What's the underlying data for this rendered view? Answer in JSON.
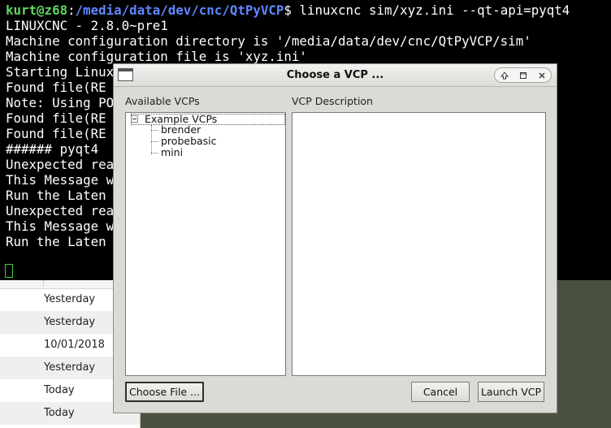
{
  "terminal": {
    "prompt_user": "kurt@z68",
    "prompt_sep": ":",
    "prompt_path": "/media/data/dev/cnc/QtPyVCP",
    "prompt_command": "$ linuxcnc sim/xyz.ini --qt-api=pyqt4",
    "lines": [
      "LINUXCNC - 2.8.0~pre1",
      "Machine configuration directory is '/media/data/dev/cnc/QtPyVCP/sim'",
      "Machine configuration file is 'xyz.ini'",
      "Starting Linux",
      "Found file(RE",
      "Note: Using PO",
      "Found file(RE",
      "Found file(RE",
      "###### pyqt4",
      "Unexpected rea",
      "This Message w",
      "Run the Laten",
      "Unexpected rea",
      "This Message w",
      "Run the Laten"
    ]
  },
  "file_list": {
    "dates": [
      "Yesterday",
      "Yesterday",
      "10/01/2018",
      "Yesterday",
      "Today",
      "Today"
    ]
  },
  "dialog": {
    "title": "Choose a VCP ...",
    "wm_buttons": {
      "shade": "shade-icon",
      "maximize": "maximize-icon",
      "close": "close-icon"
    },
    "available_label": "Available VCPs",
    "description_label": "VCP Description",
    "tree": {
      "root": "Example VCPs",
      "children": [
        "brender",
        "probebasic",
        "mini"
      ]
    },
    "buttons": {
      "choose_file": "Choose File ...",
      "cancel": "Cancel",
      "launch": "Launch VCP"
    }
  }
}
